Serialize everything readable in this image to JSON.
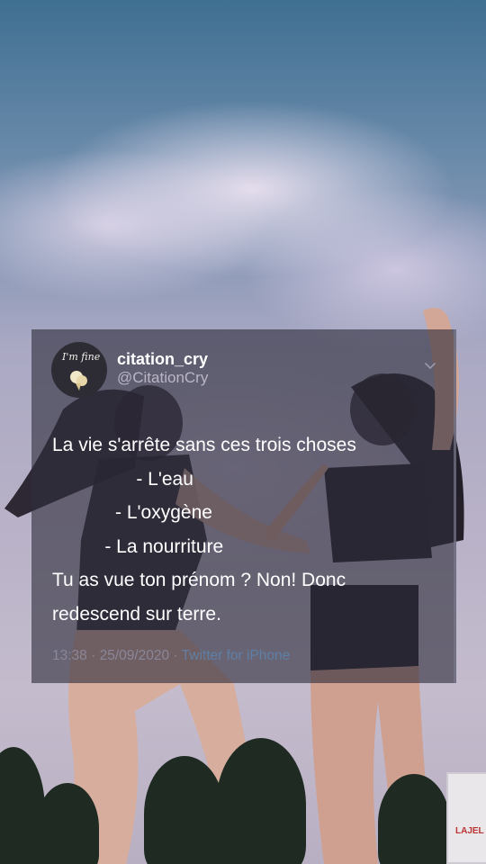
{
  "tweet": {
    "display_name": "citation_cry",
    "handle": "@CitationCry",
    "avatar_text": "I'm fine",
    "lines": [
      "La vie s'arrête sans ces trois choses",
      "                - L'eau",
      "            - L'oxygène",
      "          - La nourriture",
      "Tu as vue ton prénom ? Non! Donc",
      "redescend sur terre."
    ],
    "time": "13:38",
    "separator_1": " · ",
    "date": "25/09/2020",
    "separator_2": " · ",
    "source": "Twitter for iPhone"
  },
  "background": {
    "billboard_text": "LAJEL"
  },
  "colors": {
    "card_overlay": "#302e3e",
    "text_primary": "#ffffff",
    "text_secondary": "#b9b6c6",
    "link_source": "#5f7fa6"
  },
  "icons": {
    "menu": "chevron-down-icon",
    "avatar": "avatar-image"
  }
}
